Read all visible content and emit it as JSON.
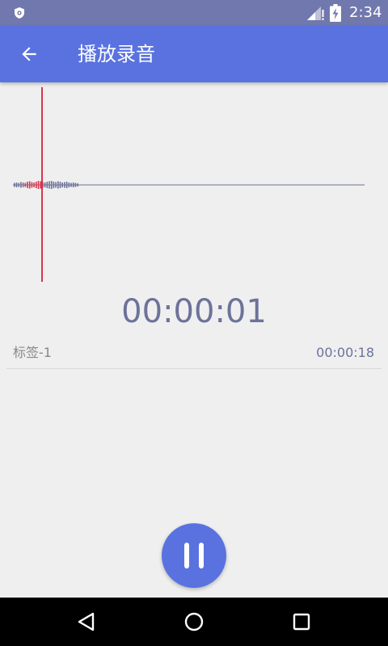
{
  "status_bar": {
    "time": "2:34",
    "icons": [
      "shield-icon",
      "signal-icon",
      "battery-charging-icon"
    ]
  },
  "app_bar": {
    "back_icon": "arrow-back-icon",
    "title": "播放录音"
  },
  "waveform": {
    "playhead_color": "#d9354d",
    "wave_color": "#6c729a",
    "played_color": "#d9354d"
  },
  "player": {
    "elapsed": "00:00:01"
  },
  "marks": [
    {
      "label": "标签-1",
      "time": "00:00:18"
    }
  ],
  "controls": {
    "pause_icon": "pause-icon"
  },
  "nav_bar": {
    "icons": [
      "back-triangle-icon",
      "home-circle-icon",
      "recents-square-icon"
    ]
  },
  "colors": {
    "status_bar": "#7178ad",
    "app_bar": "#5a72e0",
    "accent": "#5a72e0",
    "background": "#efefef",
    "text_secondary": "#6c729a"
  }
}
